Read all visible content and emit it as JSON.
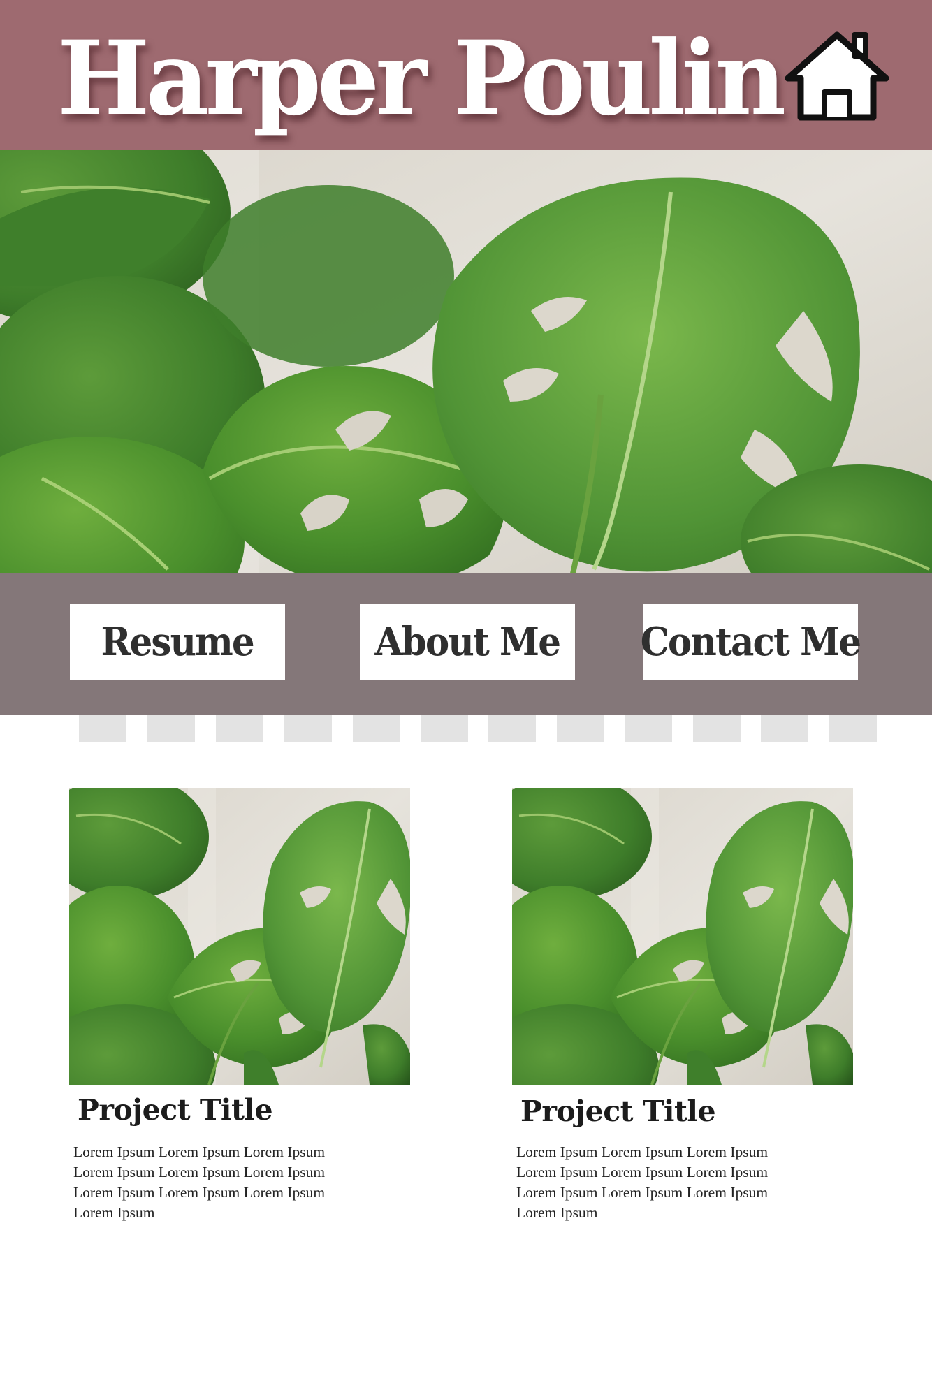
{
  "header": {
    "title": "Harper Poulin",
    "home_icon": "home-icon",
    "background": "#9e6a70"
  },
  "hero": {
    "image": "monstera-leaves-photo"
  },
  "nav": {
    "background": "#847779",
    "buttons": [
      {
        "label": "Resume"
      },
      {
        "label": "About Me"
      },
      {
        "label": "Contact Me"
      }
    ]
  },
  "projects": [
    {
      "title": "Project Title",
      "description": "Lorem Ipsum Lorem Ipsum Lorem Ipsum Lorem Ipsum Lorem Ipsum Lorem Ipsum Lorem Ipsum Lorem Ipsum Lorem Ipsum Lorem Ipsum",
      "image": "monstera-leaves-photo"
    },
    {
      "title": "Project Title",
      "description": "Lorem Ipsum Lorem Ipsum Lorem Ipsum Lorem Ipsum Lorem Ipsum Lorem Ipsum Lorem Ipsum Lorem Ipsum Lorem Ipsum Lorem Ipsum",
      "image": "monstera-leaves-photo"
    }
  ]
}
